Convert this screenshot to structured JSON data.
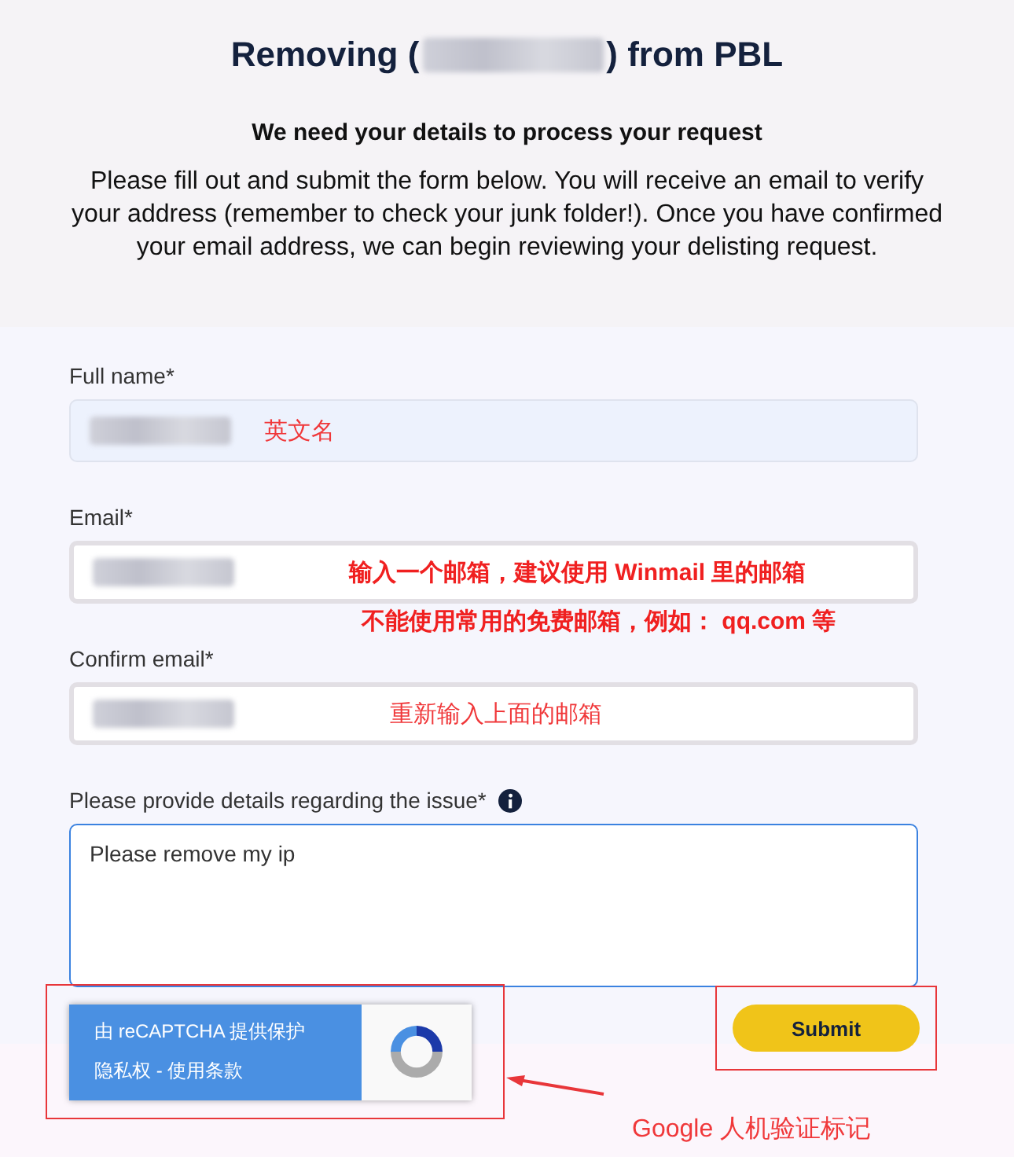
{
  "header": {
    "title_before": "Removing (",
    "title_redacted": true,
    "title_after": ") from PBL",
    "subtitle": "We need your details to process your request",
    "intro": "Please fill out and submit the form below. You will receive an email to verify your address (remember to check your junk folder!). Once you have confirmed your email address, we can begin reviewing your delisting request."
  },
  "fields": [
    {
      "kind": "input",
      "label": "Full name*",
      "redacted": true,
      "autofilled": true,
      "notes": [
        "英文名"
      ]
    },
    {
      "kind": "input",
      "label": "Email*",
      "redacted": true,
      "autofilled": false,
      "notes": [
        "输入一个邮箱，建议使用 Winmail 里的邮箱",
        "不能使用常用的免费邮箱，例如： qq.com 等"
      ]
    },
    {
      "kind": "input",
      "label": "Confirm email*",
      "redacted": true,
      "autofilled": false,
      "notes": [
        "重新输入上面的邮箱"
      ]
    },
    {
      "kind": "textarea",
      "label": "Please provide details regarding the issue*",
      "info": true,
      "value": "Please remove my ip",
      "focused": true
    }
  ],
  "recaptcha": {
    "line1": "由 reCAPTCHA 提供保护",
    "line2": "隐私权 - 使用条款"
  },
  "submit": {
    "label": "Submit"
  },
  "callout": {
    "text": "Google 人机验证标记"
  }
}
